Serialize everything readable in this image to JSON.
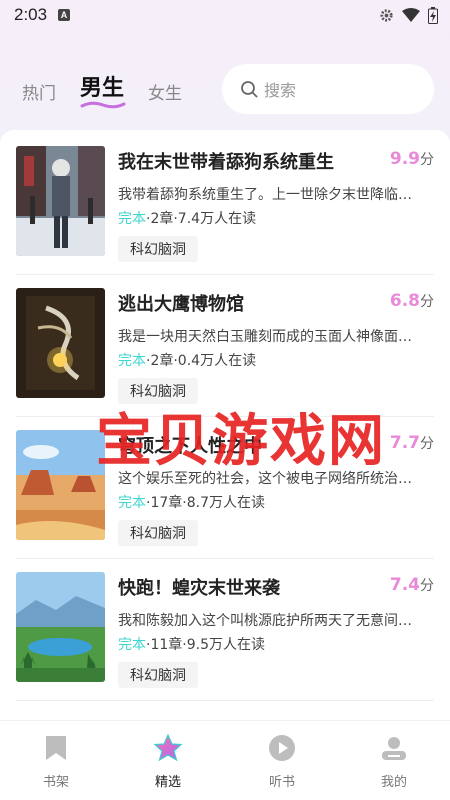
{
  "status_bar": {
    "time": "2:03",
    "notification_letter": "A",
    "icons": [
      "settings-gear-icon",
      "wifi-icon",
      "battery-icon"
    ]
  },
  "header": {
    "tabs": [
      {
        "label": "热门",
        "active": false
      },
      {
        "label": "男生",
        "active": true
      },
      {
        "label": "女生",
        "active": false
      }
    ],
    "search": {
      "placeholder": "搜索",
      "icon": "search-icon"
    }
  },
  "books": [
    {
      "title": "我在末世带着舔狗系统重生",
      "score": "9.9",
      "score_unit": "分",
      "description": "我带着舔狗系统重生了。上一世除夕末世降临…",
      "status": "完本",
      "meta": "·2章·7.4万人在读",
      "tag": "科幻脑洞"
    },
    {
      "title": "逃出大鹰博物馆",
      "score": "6.8",
      "score_unit": "分",
      "description": "我是一块用天然白玉雕刻而成的玉面人神像面…",
      "status": "完本",
      "meta": "·2章·0.4万人在读",
      "tag": "科幻脑洞"
    },
    {
      "title": "穹顶之下人性之中",
      "score": "7.7",
      "score_unit": "分",
      "description": "这个娱乐至死的社会，这个被电子网络所统治…",
      "status": "完本",
      "meta": "·17章·8.7万人在读",
      "tag": "科幻脑洞"
    },
    {
      "title": "快跑！蝗灾末世来袭",
      "score": "7.4",
      "score_unit": "分",
      "description": "我和陈毅加入这个叫桃源庇护所两天了无意间…",
      "status": "完本",
      "meta": "·11章·9.5万人在读",
      "tag": "科幻脑洞"
    }
  ],
  "watermark": "宝贝游戏网",
  "bottom_nav": [
    {
      "label": "书架",
      "icon": "bookmark-icon",
      "active": false
    },
    {
      "label": "精选",
      "icon": "star-icon",
      "active": true
    },
    {
      "label": "听书",
      "icon": "play-icon",
      "active": false
    },
    {
      "label": "我的",
      "icon": "profile-icon",
      "active": false
    }
  ],
  "colors": {
    "score": "#e88ad8",
    "status": "#3fd6d0",
    "watermark": "#e82323",
    "active_tab_underline": "#c76fe0"
  }
}
